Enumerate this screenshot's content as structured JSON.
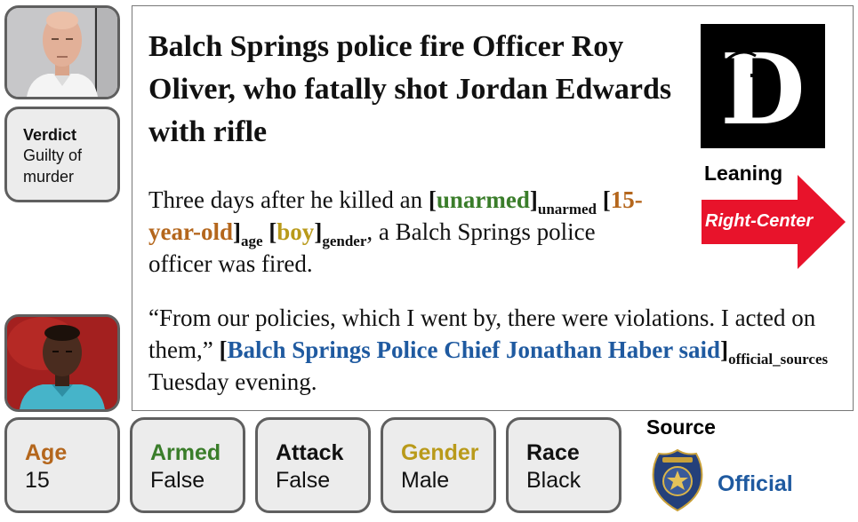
{
  "verdict": {
    "title": "Verdict",
    "text": "Guilty of murder"
  },
  "article": {
    "headline": "Balch Springs police fire Officer Roy Oliver, who fatally shot Jordan Edwards with rifle",
    "p1": {
      "t1": "Three days after he killed an ",
      "unarmed": "unarmed",
      "unarmed_tag": "unarmed",
      "age": "15-year-old",
      "age_tag": "age",
      "gender": "boy",
      "gender_tag": "gender",
      "t2": ", a Balch Springs police officer was fired."
    },
    "p2": {
      "quote": "“From our policies, which I went by, there were violations. I acted on them,” ",
      "source": "Balch Springs Police Chief Jonathan Haber said",
      "source_tag": "official_sources",
      "tail": " Tuesday evening."
    }
  },
  "leaning": {
    "label": "Leaning",
    "value": "Right-Center",
    "color": "#e8132b"
  },
  "stats": [
    {
      "title": "Age",
      "value": "15",
      "color": "#b4661c"
    },
    {
      "title": "Armed",
      "value": "False",
      "color": "#3a7d2a"
    },
    {
      "title": "Attack",
      "value": "False",
      "color": "#111111"
    },
    {
      "title": "Gender",
      "value": "Male",
      "color": "#b99a1a"
    },
    {
      "title": "Race",
      "value": "Black",
      "color": "#111111"
    }
  ],
  "source": {
    "label": "Source",
    "value": "Official",
    "icon": "police-badge-icon"
  },
  "logo_letter": "D"
}
